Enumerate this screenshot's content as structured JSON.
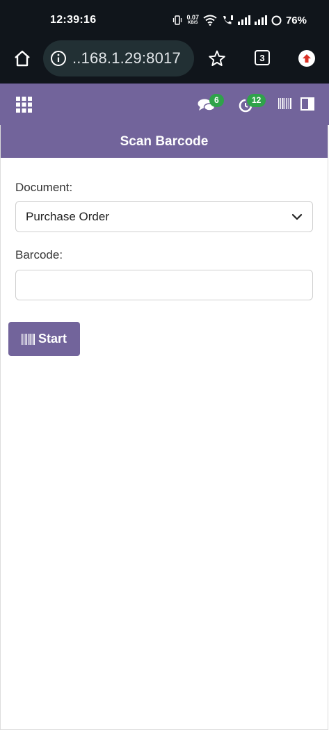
{
  "status_bar": {
    "time": "12:39:16",
    "net_speed_value": "0.07",
    "net_speed_unit": "KB/S",
    "battery": "76%"
  },
  "browser": {
    "url": "..168.1.29:8017",
    "tab_count": "3"
  },
  "navbar": {
    "messages_badge": "6",
    "activity_badge": "12",
    "accent_color": "#72649b",
    "badge_color": "#2fa34a"
  },
  "panel": {
    "title": "Scan Barcode",
    "document_label": "Document:",
    "document_value": "Purchase Order",
    "barcode_label": "Barcode:",
    "barcode_value": "",
    "start_label": "Start"
  },
  "icons": [
    "home-icon",
    "info-icon",
    "star-icon",
    "tabs-icon",
    "update-icon",
    "grid-menu-icon",
    "chat-icon",
    "clock-icon",
    "barcode-icon",
    "sidebar-toggle-icon",
    "chevron-down-icon"
  ]
}
